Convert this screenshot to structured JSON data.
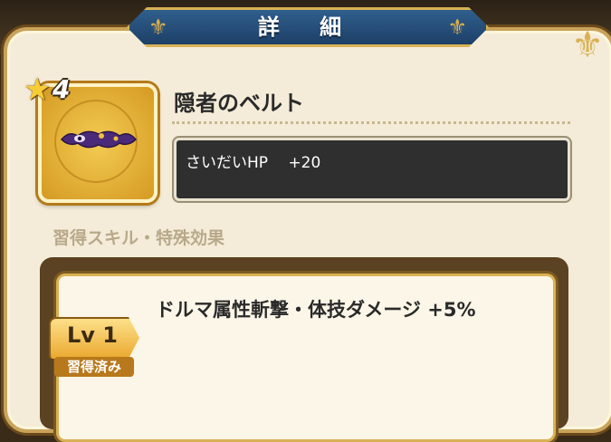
{
  "header": {
    "title": "詳 細"
  },
  "item": {
    "rarity": "4",
    "name": "隠者のベルト",
    "stat": "さいだいHP　 +20"
  },
  "skills": {
    "section_label": "習得スキル・特殊効果",
    "entries": [
      {
        "level": "Lv 1",
        "status": "習得済み",
        "text": "ドルマ属性斬撃・体技ダメージ +5%"
      }
    ]
  },
  "colors": {
    "banner": "#1d3f66",
    "gold": "#d9b154",
    "panel": "#f4ecd8"
  }
}
